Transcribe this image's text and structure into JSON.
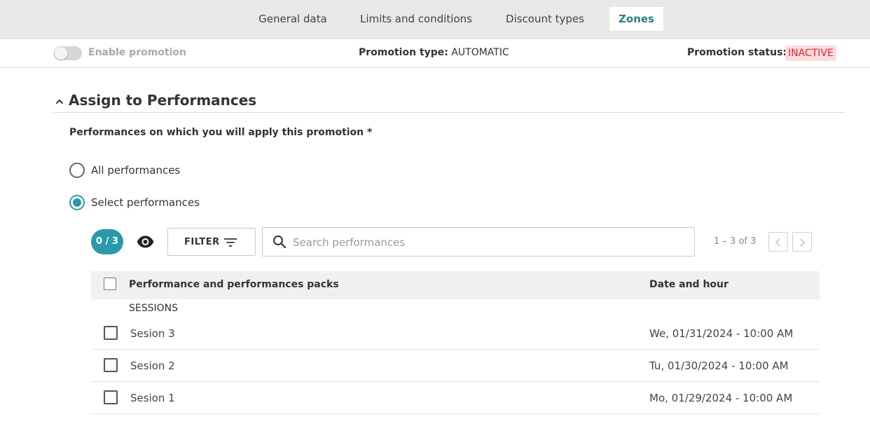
{
  "tabs": [
    {
      "label": "General data",
      "active": false
    },
    {
      "label": "Limits and conditions",
      "active": false
    },
    {
      "label": "Discount types",
      "active": false
    },
    {
      "label": "Zones",
      "active": true
    }
  ],
  "status_bar": {
    "enable_label": "Enable promotion",
    "enabled": false,
    "promotion_type_label": "Promotion type:",
    "promotion_type_value": "AUTOMATIC",
    "promotion_status_label": "Promotion status:",
    "promotion_status_value": "INACTIVE"
  },
  "section": {
    "title": "Assign to Performances",
    "question": "Performances on which you will apply this promotion *",
    "options": [
      {
        "label": "All performances",
        "selected": false
      },
      {
        "label": "Select performances",
        "selected": true
      }
    ]
  },
  "toolbar": {
    "counter": "0 / 3",
    "filter_label": "FILTER",
    "search_placeholder": "Search performances",
    "search_value": "",
    "range_text": "1 – 3 of 3"
  },
  "table": {
    "columns": [
      "Performance and performances packs",
      "Date and hour"
    ],
    "group_label": "SESSIONS",
    "rows": [
      {
        "name": "Sesion 3",
        "date": "We, 01/31/2024 - 10:00 AM",
        "checked": false
      },
      {
        "name": "Sesion 2",
        "date": "Tu, 01/30/2024 - 10:00 AM",
        "checked": false
      },
      {
        "name": "Sesion 1",
        "date": "Mo, 01/29/2024 - 10:00 AM",
        "checked": false
      }
    ]
  },
  "colors": {
    "accent": "#2a9ba6",
    "active_tab_text": "#2a7d86",
    "status_inactive_text": "#e0262f",
    "status_inactive_bg": "#fbdcdd"
  },
  "icons": {
    "section_toggle": "chevron-up-icon",
    "visibility": "eye-icon",
    "filter": "filter-icon",
    "search": "search-icon",
    "prev": "chevron-left-icon",
    "next": "chevron-right-icon"
  }
}
